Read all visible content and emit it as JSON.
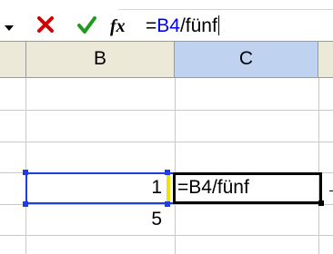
{
  "formula_bar": {
    "cancel_icon": "x-icon",
    "enter_icon": "check-icon",
    "fx_label": "fx",
    "formula_prefix": "=",
    "formula_ref": "B4",
    "formula_suffix": "/fünf",
    "colors": {
      "cancel": "#d40000",
      "enter": "#1e9a1e",
      "ref": "#0000ff"
    }
  },
  "columns": {
    "b": "B",
    "c": "C"
  },
  "cells": {
    "b4": "1",
    "c4": "=B4/fünf",
    "b5": "5"
  },
  "colors": {
    "header_bg": "#ece9d8",
    "selected_header_bg": "#bfd3f1",
    "ref_border": "#1f3de0",
    "ref_marker": "#f2e200"
  }
}
